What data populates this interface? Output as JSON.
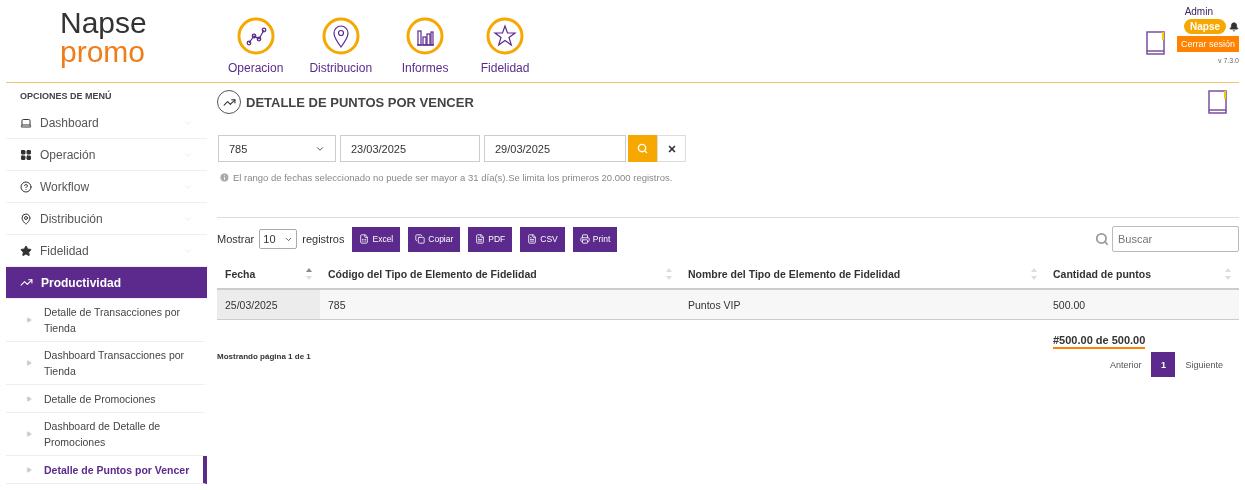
{
  "logo": {
    "line_1": "Napse",
    "line_2": "promo"
  },
  "nav": [
    {
      "label": "Operacion",
      "kind": "chart"
    },
    {
      "label": "Distribucion",
      "kind": "pin"
    },
    {
      "label": "Informes",
      "kind": "bars"
    },
    {
      "label": "Fidelidad",
      "kind": "star"
    }
  ],
  "user": {
    "name": "Admin",
    "badge": "Napse",
    "logout": "Cerrar sesión",
    "version": "v 7.3.0"
  },
  "sidebar": {
    "heading": "OPCIONES DE MENÚ",
    "items": [
      {
        "label": "Dashboard",
        "kind": "laptop",
        "expanded": false
      },
      {
        "label": "Operación",
        "kind": "grid",
        "expanded": false
      },
      {
        "label": "Workflow",
        "kind": "help",
        "expanded": false
      },
      {
        "label": "Distribución",
        "kind": "pin",
        "expanded": false
      },
      {
        "label": "Fidelidad",
        "kind": "star",
        "expanded": false
      },
      {
        "label": "Productividad",
        "kind": "trend",
        "expanded": true,
        "children": [
          {
            "label": "Detalle de Transacciones por Tienda",
            "selected": false
          },
          {
            "label": "Dashboard Transacciones por Tienda",
            "selected": false
          },
          {
            "label": "Detalle de Promociones",
            "selected": false
          },
          {
            "label": "Dashboard de Detalle de Promociones",
            "selected": false
          },
          {
            "label": "Detalle de Puntos por Vencer",
            "selected": true
          }
        ]
      }
    ]
  },
  "page": {
    "title": "DETALLE DE PUNTOS POR VENCER"
  },
  "filters": {
    "code": "785",
    "date_from": "23/03/2025",
    "date_to": "29/03/2025",
    "note": "El rango de fechas seleccionado no puede ser mayor a 31 día(s).Se limita los primeros 20.000 registros."
  },
  "table_tools": {
    "show_label": "Mostrar",
    "page_size": "10",
    "records_label": "registros",
    "buttons": [
      {
        "label": "Excel",
        "kind": "excel"
      },
      {
        "label": "Copiar",
        "kind": "copy"
      },
      {
        "label": "PDF",
        "kind": "pdf"
      },
      {
        "label": "CSV",
        "kind": "csv"
      },
      {
        "label": "Print",
        "kind": "print"
      }
    ],
    "search_placeholder": "Buscar"
  },
  "table": {
    "columns": [
      {
        "label": "Fecha",
        "sorted": true
      },
      {
        "label": "Código del Tipo de Elemento de Fidelidad",
        "sorted": false
      },
      {
        "label": "Nombre del Tipo de Elemento de Fidelidad",
        "sorted": false
      },
      {
        "label": "Cantidad de puntos",
        "sorted": false
      }
    ],
    "rows": [
      [
        "25/03/2025",
        "785",
        "Puntos VIP",
        "500.00"
      ]
    ],
    "total": "**#500.00 de 500.00**"
  },
  "footer": {
    "info": "Mostrando página 1 de 1",
    "prev": "Anterior",
    "pages": [
      {
        "label": "1",
        "selected": true
      }
    ],
    "next": "Siguiente"
  }
}
